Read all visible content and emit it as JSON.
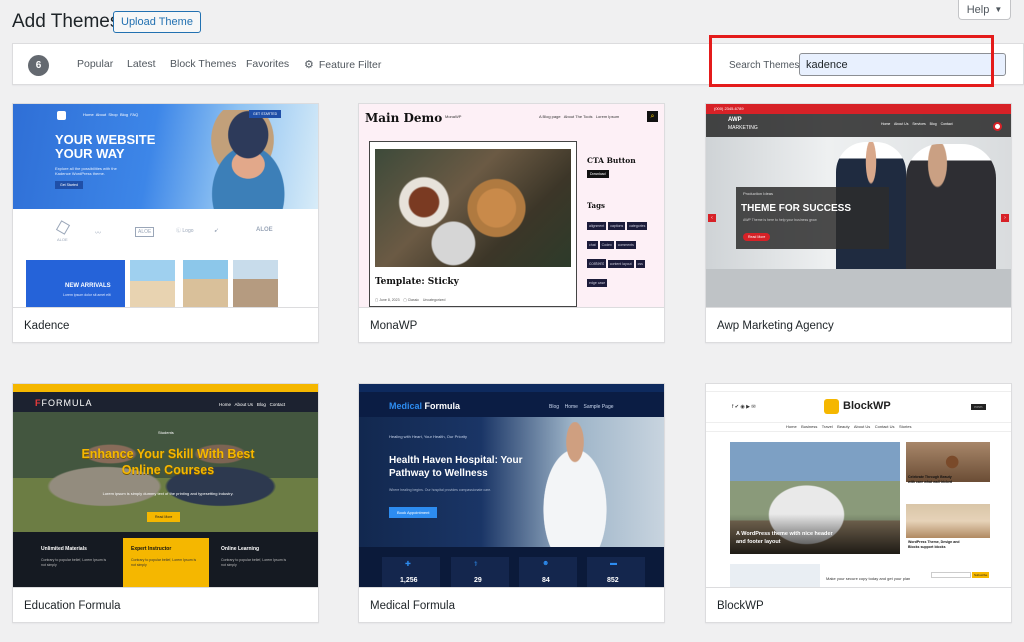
{
  "header": {
    "title": "Add Themes",
    "upload_label": "Upload Theme",
    "help_label": "Help"
  },
  "filter": {
    "count": "6",
    "tabs": [
      "Popular",
      "Latest",
      "Block Themes",
      "Favorites"
    ],
    "feature_filter": "Feature Filter",
    "search_label": "Search Themes",
    "search_value": "kadence"
  },
  "themes": [
    {
      "name": "Kadence",
      "shot": {
        "nav": [
          "Home",
          "About",
          "Shop",
          "Blog",
          "FAQ"
        ],
        "cta": "GET STARTED",
        "hero_title": [
          "YOUR WEBSITE",
          "YOUR WAY"
        ],
        "hero_text": [
          "Explore all the possibilities with the",
          "Kadence WordPress theme."
        ],
        "hero_btn": "Get Started",
        "logos": [
          "ALOE",
          "Logo",
          "ALOE"
        ],
        "arrivals": "NEW ARRIVALS",
        "arrivals_sub": "Lorem ipsum dolor sit amet elit"
      }
    },
    {
      "name": "MonaWP",
      "shot": {
        "logo": "Main Demo",
        "tag": "MonaWP",
        "nav": [
          "A Blog page",
          "About The Tools",
          "Lorem Ipsum"
        ],
        "post_title": "Template: Sticky",
        "meta": [
          "June 8, 2023",
          "Classic",
          "Uncategorized"
        ],
        "cta_title": "CTA Button",
        "cta_btn": "Download",
        "tags_title": "Tags",
        "tags": [
          "alignment",
          "captions",
          "categories",
          "chat",
          "Codex",
          "comments",
          "content",
          "content layout",
          "css",
          "edge case"
        ]
      }
    },
    {
      "name": "Awp Marketing Agency",
      "shot": {
        "topbar": "(000) 2345-6789",
        "logo": "AWP",
        "logo_sub": "MARKETING",
        "nav": [
          "Home",
          "About Us",
          "Services",
          "Blog",
          "Contact"
        ],
        "kicker": "Production Ideas",
        "headline": "THEME FOR SUCCESS",
        "sub": "AWP Theme is here to help your business grow",
        "btn": "Read More"
      }
    },
    {
      "name": "Education Formula",
      "shot": {
        "logo": "FORMULA",
        "nav": [
          "Home",
          "About Us",
          "Blog",
          "Contact"
        ],
        "badge": "Students",
        "headline": [
          "Enhance Your Skill With Best",
          "Online Courses"
        ],
        "sub": "Lorem ipsum is simply dummy text of the printing and typesetting industry.",
        "btn": "Read More",
        "features": [
          "Unlimited Materials",
          "Expert Instructor",
          "Online Learning"
        ],
        "feat_text": "Contrary to popular belief, Lorem Ipsum is not simply"
      }
    },
    {
      "name": "Medical Formula",
      "shot": {
        "logo_a": "Medical",
        "logo_b": "Formula",
        "nav": [
          "Blog",
          "Home",
          "Sample Page"
        ],
        "kicker": "Healing with Heart, Your Health, Our Priority",
        "headline": [
          "Health Haven Hospital: Your",
          "Pathway to Wellness"
        ],
        "sub": "Where healing begins. Our hospital provides compassionate care.",
        "btn": "Book Appointment",
        "stats": [
          "1,256",
          "29",
          "84",
          "852"
        ]
      }
    },
    {
      "name": "BlockWP",
      "shot": {
        "logo": "BlockWP",
        "nav": [
          "Home",
          "Business",
          "Travel",
          "Beauty",
          "About Us",
          "Contact Us",
          "Stories"
        ],
        "main_title": [
          "A WordPress theme with nice header",
          "and footer layout"
        ],
        "side_title": [
          "Celebrate Through Beauty",
          "with care what wall tricked"
        ],
        "side_title2": [
          "WordPress Theme, Design and",
          "Blocks support blocks"
        ],
        "bottom_text": "Make your secure copy today and get your plan",
        "subscribe": "Subscribe"
      }
    }
  ],
  "colors": {
    "accent": "#2271b1",
    "highlight": "#e41b1b"
  }
}
